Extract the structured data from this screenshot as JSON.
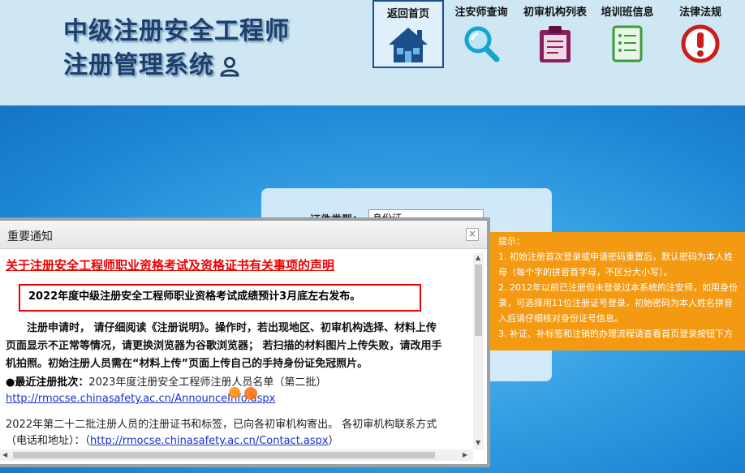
{
  "header": {
    "title_line1": "中级注册安全工程师",
    "title_line2": "注册管理系统",
    "nav": [
      {
        "label": "返回首页",
        "icon": "home-icon",
        "active": true
      },
      {
        "label": "注安师查询",
        "icon": "magnifier-icon",
        "active": false
      },
      {
        "label": "初审机构列表",
        "icon": "clipboard-icon",
        "active": false
      },
      {
        "label": "培训班信息",
        "icon": "document-list-icon",
        "active": false
      },
      {
        "label": "法律法规",
        "icon": "alert-icon",
        "active": false
      }
    ]
  },
  "login": {
    "cert_type_label": "证件类型：",
    "cert_type_value": "身份证"
  },
  "tip": {
    "title": "提示：",
    "lines": [
      "1. 初始注册首次登录或申请密码重置后，默认密码为本人姓",
      "母（每个字的拼音首字母，不区分大小写）。",
      "2. 2012年以前已注册但未登录过本系统的注安师，如用身份",
      "录，可选择用11位注册证号登录，初始密码为本人姓名拼音",
      "入后请仔细核对身份证号信息。",
      "3. 补证、补标签和注销的办理流程请查看首页登录按钮下方"
    ]
  },
  "modal": {
    "title": "重要通知",
    "close": "×",
    "declaration": "关于注册安全工程师职业资格考试及资格证书有关事项的声明",
    "notice": "2022年度中级注册安全工程师职业资格考试成绩预计3月底左右发布。",
    "para_lines": [
      "注册申请时，  请仔细阅读《注册说明》。操作时，若出现地区、初审机构选择、材料上传",
      "页面显示不正常等情况，请更换浏览器为谷歌浏览器；  若扫描的材料图片上传失败，请改用手",
      "机拍照。初始注册人员需在“材料上传”页面上传自己的手持身份证免冠照片。"
    ],
    "batch_label": "●最近注册批次：",
    "batch_text": "2023年度注册安全工程师注册人员名单（第二批）",
    "batch_link": "http://rmocse.chinasafety.ac.cn/AnnounceInfo.aspx",
    "para2_line1": "2022年第二十二批注册人员的注册证书和标签，已向各初审机构寄出。  各初审机构联系方式",
    "para2_prefix": "（电话和地址）：（",
    "para2_link": "http://rmocse.chinasafety.ac.cn/Contact.aspx",
    "para2_suffix": "）"
  }
}
